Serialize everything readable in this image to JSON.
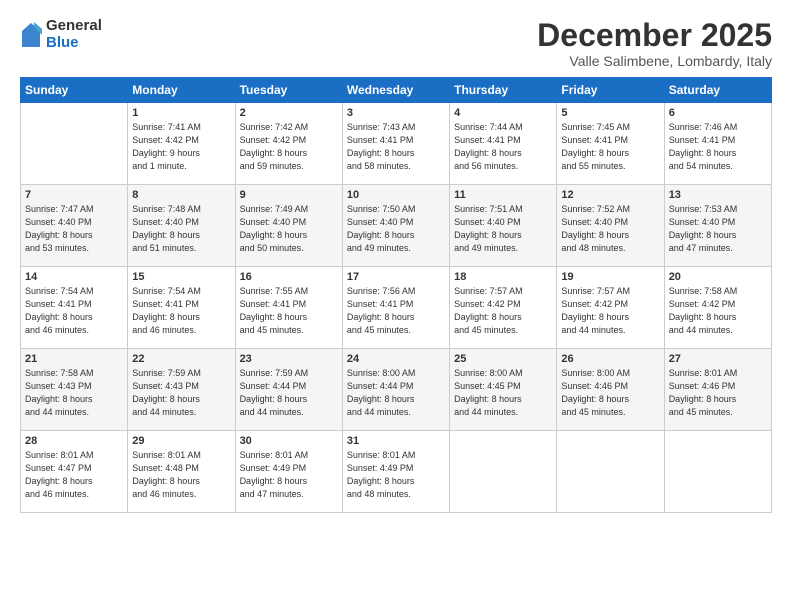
{
  "logo": {
    "general": "General",
    "blue": "Blue"
  },
  "title": "December 2025",
  "location": "Valle Salimbene, Lombardy, Italy",
  "headers": [
    "Sunday",
    "Monday",
    "Tuesday",
    "Wednesday",
    "Thursday",
    "Friday",
    "Saturday"
  ],
  "weeks": [
    [
      {
        "day": "",
        "info": ""
      },
      {
        "day": "1",
        "info": "Sunrise: 7:41 AM\nSunset: 4:42 PM\nDaylight: 9 hours\nand 1 minute."
      },
      {
        "day": "2",
        "info": "Sunrise: 7:42 AM\nSunset: 4:42 PM\nDaylight: 8 hours\nand 59 minutes."
      },
      {
        "day": "3",
        "info": "Sunrise: 7:43 AM\nSunset: 4:41 PM\nDaylight: 8 hours\nand 58 minutes."
      },
      {
        "day": "4",
        "info": "Sunrise: 7:44 AM\nSunset: 4:41 PM\nDaylight: 8 hours\nand 56 minutes."
      },
      {
        "day": "5",
        "info": "Sunrise: 7:45 AM\nSunset: 4:41 PM\nDaylight: 8 hours\nand 55 minutes."
      },
      {
        "day": "6",
        "info": "Sunrise: 7:46 AM\nSunset: 4:41 PM\nDaylight: 8 hours\nand 54 minutes."
      }
    ],
    [
      {
        "day": "7",
        "info": "Sunrise: 7:47 AM\nSunset: 4:40 PM\nDaylight: 8 hours\nand 53 minutes."
      },
      {
        "day": "8",
        "info": "Sunrise: 7:48 AM\nSunset: 4:40 PM\nDaylight: 8 hours\nand 51 minutes."
      },
      {
        "day": "9",
        "info": "Sunrise: 7:49 AM\nSunset: 4:40 PM\nDaylight: 8 hours\nand 50 minutes."
      },
      {
        "day": "10",
        "info": "Sunrise: 7:50 AM\nSunset: 4:40 PM\nDaylight: 8 hours\nand 49 minutes."
      },
      {
        "day": "11",
        "info": "Sunrise: 7:51 AM\nSunset: 4:40 PM\nDaylight: 8 hours\nand 49 minutes."
      },
      {
        "day": "12",
        "info": "Sunrise: 7:52 AM\nSunset: 4:40 PM\nDaylight: 8 hours\nand 48 minutes."
      },
      {
        "day": "13",
        "info": "Sunrise: 7:53 AM\nSunset: 4:40 PM\nDaylight: 8 hours\nand 47 minutes."
      }
    ],
    [
      {
        "day": "14",
        "info": "Sunrise: 7:54 AM\nSunset: 4:41 PM\nDaylight: 8 hours\nand 46 minutes."
      },
      {
        "day": "15",
        "info": "Sunrise: 7:54 AM\nSunset: 4:41 PM\nDaylight: 8 hours\nand 46 minutes."
      },
      {
        "day": "16",
        "info": "Sunrise: 7:55 AM\nSunset: 4:41 PM\nDaylight: 8 hours\nand 45 minutes."
      },
      {
        "day": "17",
        "info": "Sunrise: 7:56 AM\nSunset: 4:41 PM\nDaylight: 8 hours\nand 45 minutes."
      },
      {
        "day": "18",
        "info": "Sunrise: 7:57 AM\nSunset: 4:42 PM\nDaylight: 8 hours\nand 45 minutes."
      },
      {
        "day": "19",
        "info": "Sunrise: 7:57 AM\nSunset: 4:42 PM\nDaylight: 8 hours\nand 44 minutes."
      },
      {
        "day": "20",
        "info": "Sunrise: 7:58 AM\nSunset: 4:42 PM\nDaylight: 8 hours\nand 44 minutes."
      }
    ],
    [
      {
        "day": "21",
        "info": "Sunrise: 7:58 AM\nSunset: 4:43 PM\nDaylight: 8 hours\nand 44 minutes."
      },
      {
        "day": "22",
        "info": "Sunrise: 7:59 AM\nSunset: 4:43 PM\nDaylight: 8 hours\nand 44 minutes."
      },
      {
        "day": "23",
        "info": "Sunrise: 7:59 AM\nSunset: 4:44 PM\nDaylight: 8 hours\nand 44 minutes."
      },
      {
        "day": "24",
        "info": "Sunrise: 8:00 AM\nSunset: 4:44 PM\nDaylight: 8 hours\nand 44 minutes."
      },
      {
        "day": "25",
        "info": "Sunrise: 8:00 AM\nSunset: 4:45 PM\nDaylight: 8 hours\nand 44 minutes."
      },
      {
        "day": "26",
        "info": "Sunrise: 8:00 AM\nSunset: 4:46 PM\nDaylight: 8 hours\nand 45 minutes."
      },
      {
        "day": "27",
        "info": "Sunrise: 8:01 AM\nSunset: 4:46 PM\nDaylight: 8 hours\nand 45 minutes."
      }
    ],
    [
      {
        "day": "28",
        "info": "Sunrise: 8:01 AM\nSunset: 4:47 PM\nDaylight: 8 hours\nand 46 minutes."
      },
      {
        "day": "29",
        "info": "Sunrise: 8:01 AM\nSunset: 4:48 PM\nDaylight: 8 hours\nand 46 minutes."
      },
      {
        "day": "30",
        "info": "Sunrise: 8:01 AM\nSunset: 4:49 PM\nDaylight: 8 hours\nand 47 minutes."
      },
      {
        "day": "31",
        "info": "Sunrise: 8:01 AM\nSunset: 4:49 PM\nDaylight: 8 hours\nand 48 minutes."
      },
      {
        "day": "",
        "info": ""
      },
      {
        "day": "",
        "info": ""
      },
      {
        "day": "",
        "info": ""
      }
    ]
  ]
}
